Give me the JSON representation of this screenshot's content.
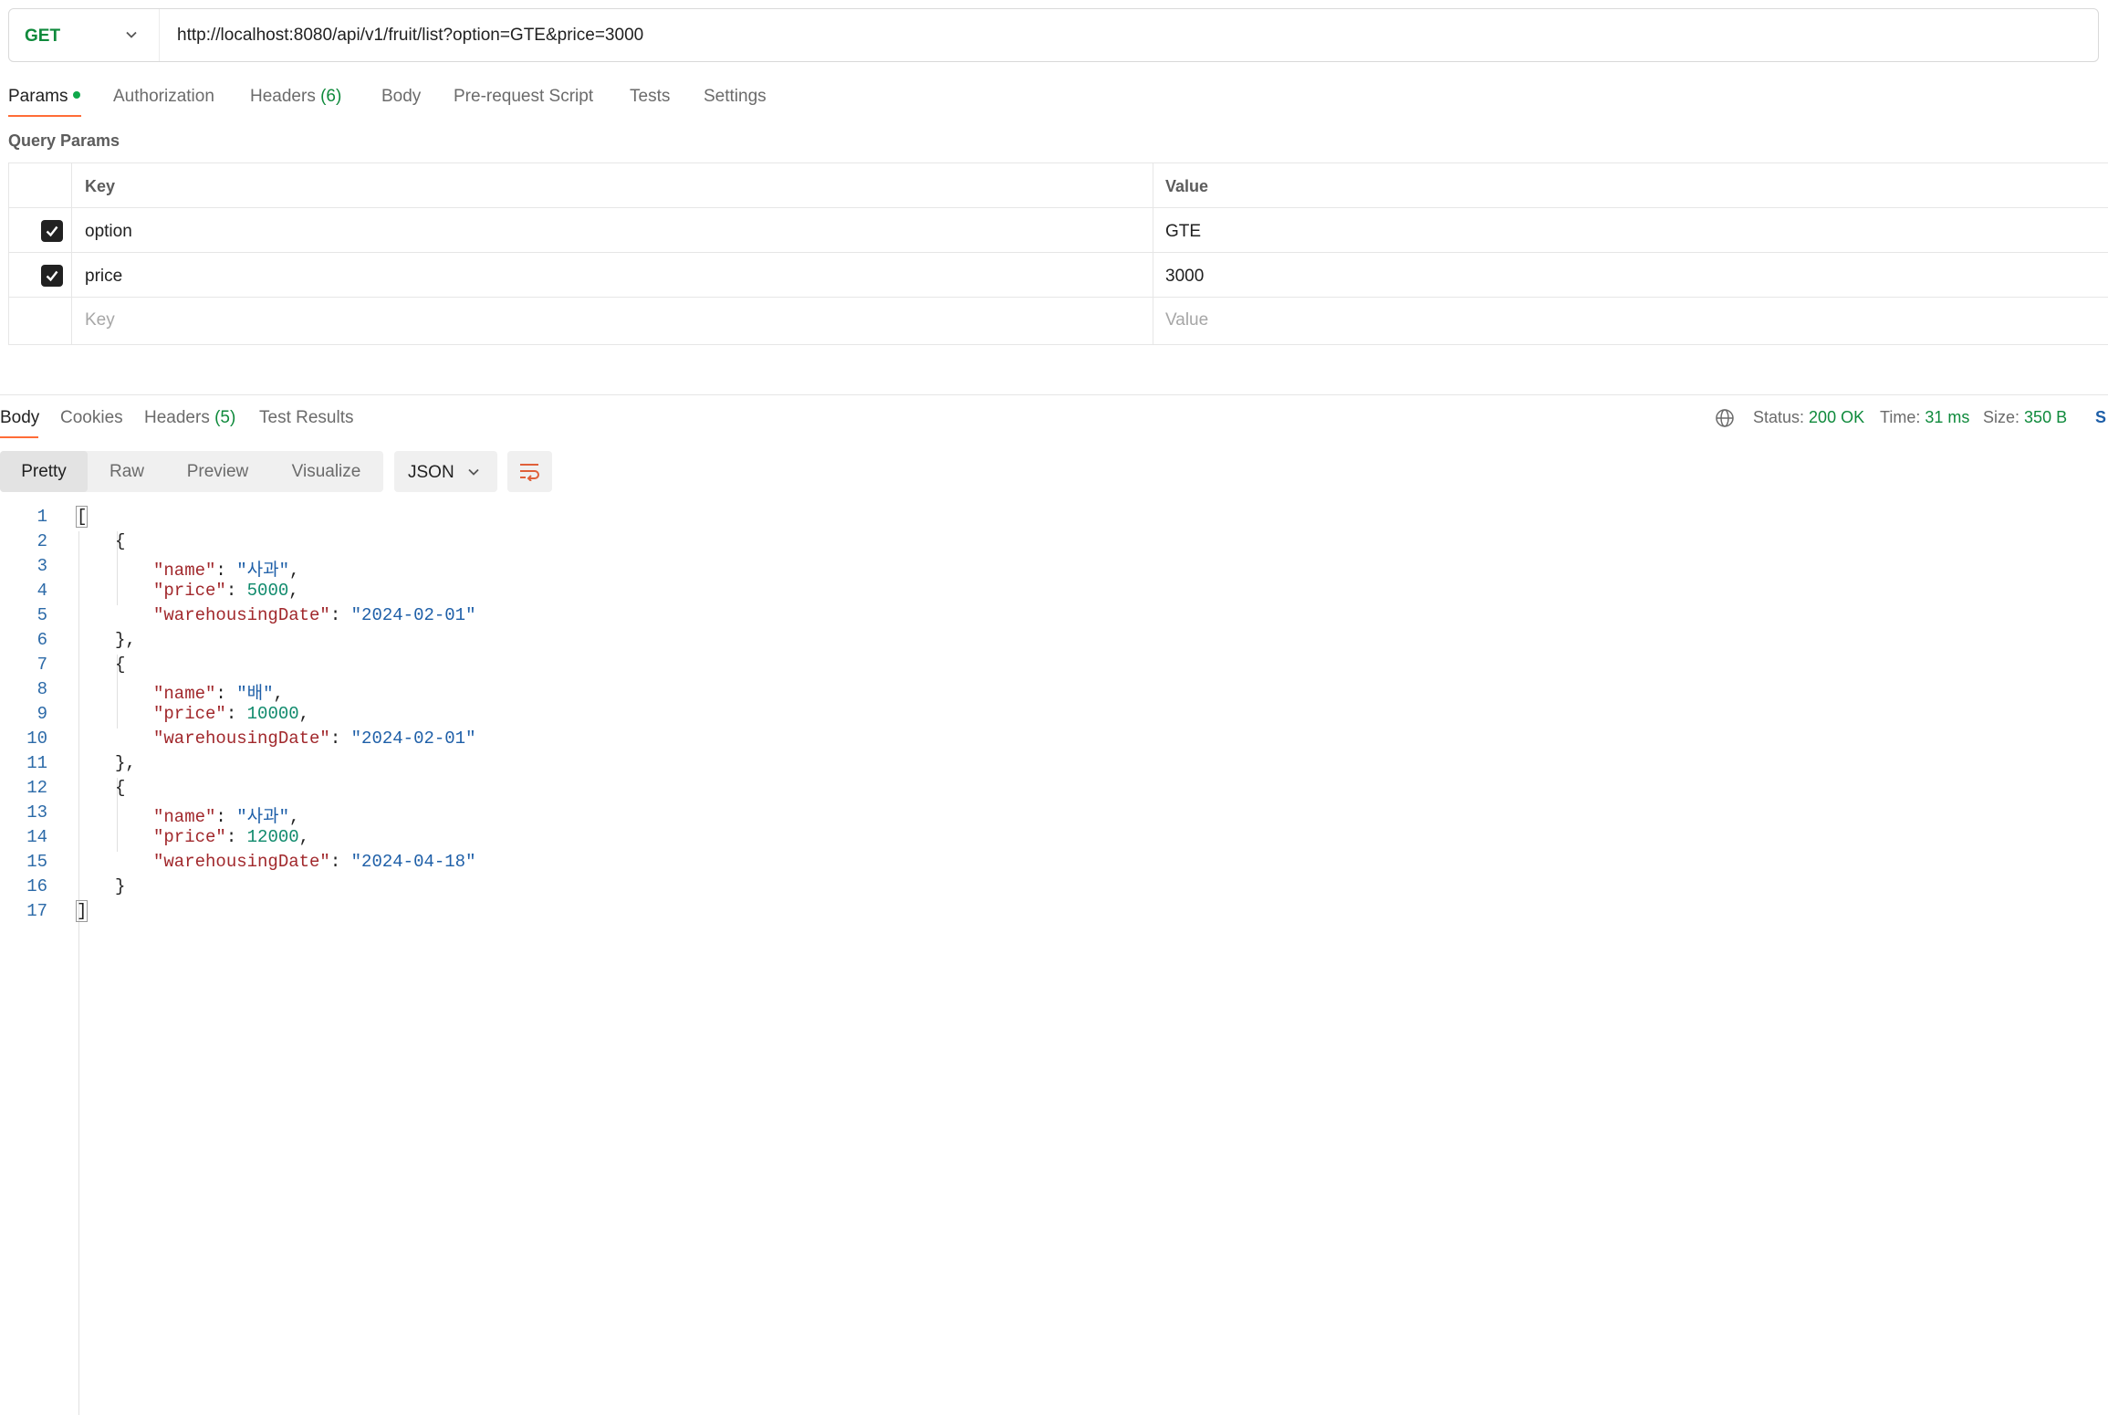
{
  "request": {
    "method": "GET",
    "url": "http://localhost:8080/api/v1/fruit/list?option=GTE&price=3000"
  },
  "request_tabs": [
    {
      "label": "Params",
      "active": true
    },
    {
      "label": "Authorization"
    },
    {
      "label": "Headers",
      "count": "(6)"
    },
    {
      "label": "Body"
    },
    {
      "label": "Pre-request Script"
    },
    {
      "label": "Tests"
    },
    {
      "label": "Settings"
    }
  ],
  "query_params": {
    "title": "Query Params",
    "headers": {
      "key": "Key",
      "value": "Value"
    },
    "rows": [
      {
        "key": "option",
        "value": "GTE",
        "checked": true
      },
      {
        "key": "price",
        "value": "3000",
        "checked": true
      }
    ],
    "placeholder": {
      "key": "Key",
      "value": "Value"
    }
  },
  "response_tabs": [
    {
      "label": "Body",
      "active": true
    },
    {
      "label": "Cookies"
    },
    {
      "label": "Headers",
      "count": "(5)"
    },
    {
      "label": "Test Results"
    }
  ],
  "status": {
    "status_label": "Status:",
    "status_value": "200 OK",
    "time_label": "Time:",
    "time_value": "31 ms",
    "size_label": "Size:",
    "size_value": "350 B",
    "save_label": "S"
  },
  "view_modes": [
    "Pretty",
    "Raw",
    "Preview",
    "Visualize"
  ],
  "format": "JSON",
  "code_lines": [
    {
      "n": "1",
      "indent": 0,
      "t": "["
    },
    {
      "n": "2",
      "indent": 1,
      "t": "{"
    },
    {
      "n": "3",
      "indent": 2,
      "k": "\"name\"",
      "v": "\"사과\"",
      "vt": "str",
      "c": ","
    },
    {
      "n": "4",
      "indent": 2,
      "k": "\"price\"",
      "v": "5000",
      "vt": "num",
      "c": ","
    },
    {
      "n": "5",
      "indent": 2,
      "k": "\"warehousingDate\"",
      "v": "\"2024-02-01\"",
      "vt": "str",
      "c": ""
    },
    {
      "n": "6",
      "indent": 1,
      "t": "},"
    },
    {
      "n": "7",
      "indent": 1,
      "t": "{"
    },
    {
      "n": "8",
      "indent": 2,
      "k": "\"name\"",
      "v": "\"배\"",
      "vt": "str",
      "c": ","
    },
    {
      "n": "9",
      "indent": 2,
      "k": "\"price\"",
      "v": "10000",
      "vt": "num",
      "c": ","
    },
    {
      "n": "10",
      "indent": 2,
      "k": "\"warehousingDate\"",
      "v": "\"2024-02-01\"",
      "vt": "str",
      "c": ""
    },
    {
      "n": "11",
      "indent": 1,
      "t": "},"
    },
    {
      "n": "12",
      "indent": 1,
      "t": "{"
    },
    {
      "n": "13",
      "indent": 2,
      "k": "\"name\"",
      "v": "\"사과\"",
      "vt": "str",
      "c": ","
    },
    {
      "n": "14",
      "indent": 2,
      "k": "\"price\"",
      "v": "12000",
      "vt": "num",
      "c": ","
    },
    {
      "n": "15",
      "indent": 2,
      "k": "\"warehousingDate\"",
      "v": "\"2024-04-18\"",
      "vt": "str",
      "c": ""
    },
    {
      "n": "16",
      "indent": 1,
      "t": "}"
    },
    {
      "n": "17",
      "indent": 0,
      "t": "]"
    }
  ],
  "colors": {
    "method_get": "#0f8a3c",
    "accent": "#ff6c37",
    "json_key": "#a1282c",
    "json_string": "#1e5fa8",
    "json_number": "#0f8a6c",
    "status_ok": "#0f8a3c"
  },
  "icons": [
    "chevron-down-icon",
    "checkbox-checked-icon",
    "globe-icon",
    "wrap-lines-icon"
  ]
}
